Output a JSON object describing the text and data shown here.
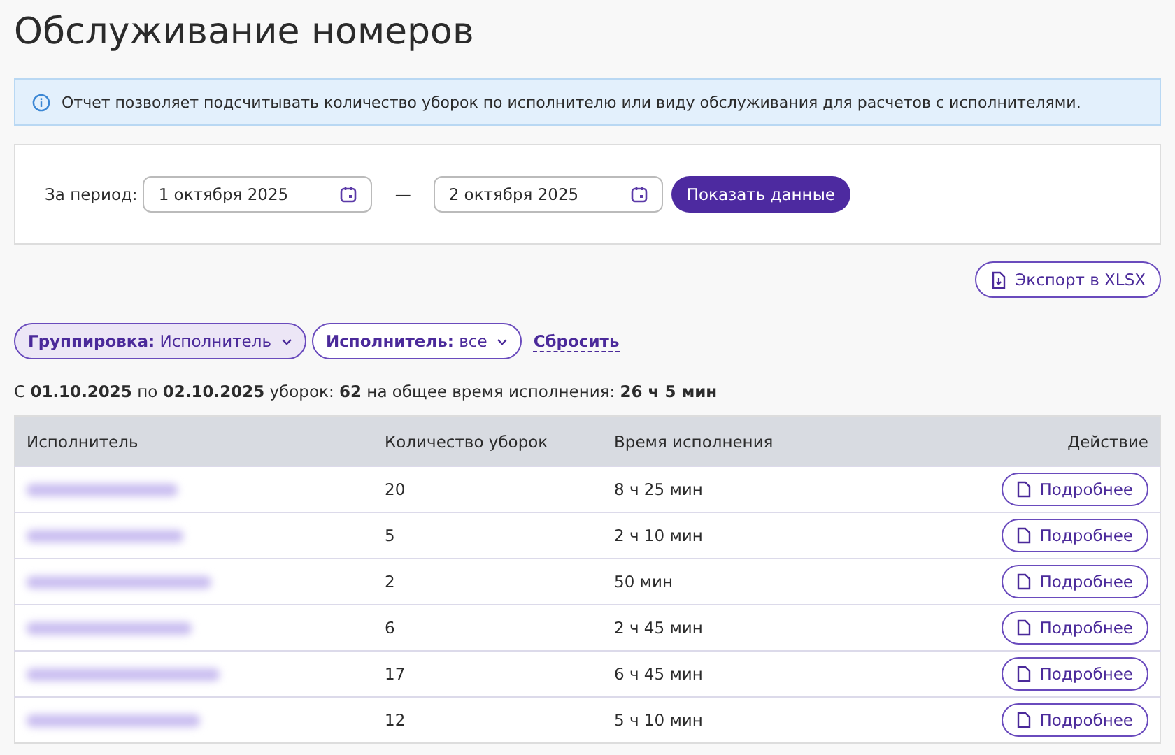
{
  "title": "Обслуживание номеров",
  "info": "Отчет позволяет подсчитывать количество уборок по исполнителю или виду обслуживания для расчетов с исполнителями.",
  "filter": {
    "label": "За период:",
    "date_from": "1 октября 2025",
    "separator": "—",
    "date_to": "2 октября 2025",
    "submit": "Показать данные"
  },
  "export_button": "Экспорт в XLSX",
  "chips": [
    {
      "label": "**Группировка:** Исполнитель",
      "active": true
    },
    {
      "label": "**Исполнитель:** все",
      "active": false
    }
  ],
  "reset_link": "Сбросить",
  "summary": "С **01.10.2025** по **02.10.2025** уборок: **62** на общее время исполнения: **26 ч 5 мин**",
  "table": {
    "columns": [
      "Исполнитель",
      "Количество уборок",
      "Время исполнения",
      "Действие"
    ],
    "rows": [
      {
        "count": "20",
        "time": "8 ч 25 мин",
        "action": "Подробнее"
      },
      {
        "count": "5",
        "time": "2 ч 10 мин",
        "action": "Подробнее"
      },
      {
        "count": "2",
        "time": "50 мин",
        "action": "Подробнее"
      },
      {
        "count": "6",
        "time": "2 ч 45 мин",
        "action": "Подробнее"
      },
      {
        "count": "17",
        "time": "6 ч 45 мин",
        "action": "Подробнее"
      },
      {
        "count": "12",
        "time": "5 ч 10 мин",
        "action": "Подробнее"
      }
    ]
  }
}
